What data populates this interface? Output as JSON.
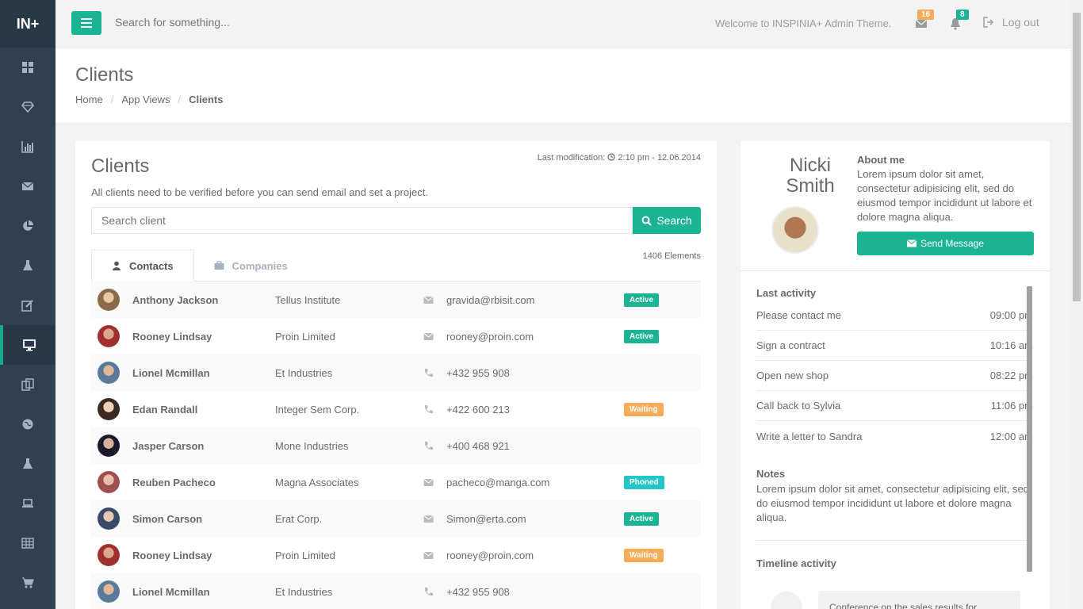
{
  "app": {
    "logo": "IN+"
  },
  "topbar": {
    "search_placeholder": "Search for something...",
    "welcome": "Welcome to INSPINIA+ Admin Theme.",
    "mail_count": "16",
    "alert_count": "8",
    "logout": "Log out"
  },
  "heading": {
    "title": "Clients",
    "breadcrumb": [
      "Home",
      "App Views",
      "Clients"
    ]
  },
  "clients": {
    "title": "Clients",
    "last_mod_label": "Last modification:",
    "last_mod_value": "2:10 pm - 12.06.2014",
    "description": "All clients need to be verified before you can send email and set a project.",
    "search_placeholder": "Search client",
    "search_button": "Search",
    "elements_count": "1406 Elements",
    "tabs": [
      "Contacts",
      "Companies"
    ],
    "rows": [
      {
        "name": "Anthony Jackson",
        "company": "Tellus Institute",
        "contact_type": "email",
        "contact": "gravida@rbisit.com",
        "status": "Active"
      },
      {
        "name": "Rooney Lindsay",
        "company": "Proin Limited",
        "contact_type": "email",
        "contact": "rooney@proin.com",
        "status": "Active"
      },
      {
        "name": "Lionel Mcmillan",
        "company": "Et Industries",
        "contact_type": "phone",
        "contact": "+432 955 908",
        "status": ""
      },
      {
        "name": "Edan Randall",
        "company": "Integer Sem Corp.",
        "contact_type": "phone",
        "contact": "+422 600 213",
        "status": "Waiting"
      },
      {
        "name": "Jasper Carson",
        "company": "Mone Industries",
        "contact_type": "phone",
        "contact": "+400 468 921",
        "status": ""
      },
      {
        "name": "Reuben Pacheco",
        "company": "Magna Associates",
        "contact_type": "email",
        "contact": "pacheco@manga.com",
        "status": "Phoned"
      },
      {
        "name": "Simon Carson",
        "company": "Erat Corp.",
        "contact_type": "email",
        "contact": "Simon@erta.com",
        "status": "Active"
      },
      {
        "name": "Rooney Lindsay",
        "company": "Proin Limited",
        "contact_type": "email",
        "contact": "rooney@proin.com",
        "status": "Waiting"
      },
      {
        "name": "Lionel Mcmillan",
        "company": "Et Industries",
        "contact_type": "phone",
        "contact": "+432 955 908",
        "status": ""
      }
    ]
  },
  "profile": {
    "first_name": "Nicki",
    "last_name": "Smith",
    "about_title": "About me",
    "about_text": "Lorem ipsum dolor sit amet, consectetur adipisicing elit, sed do eiusmod tempor incididunt ut labore et dolore magna aliqua.",
    "send_button": "Send Message",
    "last_activity_title": "Last activity",
    "activities": [
      {
        "label": "Please contact me",
        "time": "09:00 pm"
      },
      {
        "label": "Sign a contract",
        "time": "10:16 am"
      },
      {
        "label": "Open new shop",
        "time": "08:22 pm"
      },
      {
        "label": "Call back to Sylvia",
        "time": "11:06 pm"
      },
      {
        "label": "Write a letter to Sandra",
        "time": "12:00 am"
      }
    ],
    "notes_title": "Notes",
    "notes_text": "Lorem ipsum dolor sit amet, consectetur adipisicing elit, sed do eiusmod tempor incididunt ut labore et dolore magna aliqua.",
    "timeline_title": "Timeline activity",
    "timeline_item": "Conference on the sales results for"
  },
  "colors": {
    "accent": "#1ab394",
    "waiting": "#f8ac59",
    "phoned": "#23c6c8",
    "sidebar": "#2f4050"
  },
  "sidebar_icons": [
    "dashboard-icon",
    "diamond-icon",
    "bar-chart-icon",
    "envelope-icon",
    "pie-chart-icon",
    "flask-icon",
    "edit-icon",
    "desktop-icon",
    "files-icon",
    "globe-icon",
    "flask-icon",
    "laptop-icon",
    "table-icon",
    "cart-icon"
  ]
}
